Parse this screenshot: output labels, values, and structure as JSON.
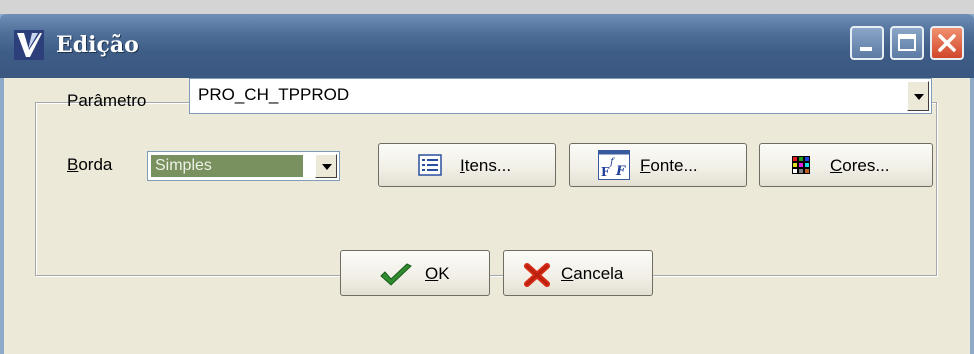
{
  "window": {
    "title": "Edição",
    "minimize_icon": "minimize-icon",
    "maximize_icon": "maximize-icon",
    "close_icon": "close-icon",
    "app_icon": "app-logo-icon"
  },
  "form": {
    "parametro": {
      "label": "Parâmetro",
      "value": "PRO_CH_TPPROD"
    },
    "borda": {
      "label_mnemonic": "B",
      "label_rest": "orda",
      "value": "Simples"
    }
  },
  "buttons": {
    "itens": {
      "mnemonic": "I",
      "rest": "tens...",
      "icon": "list-icon"
    },
    "fonte": {
      "mnemonic": "F",
      "rest": "onte...",
      "icon": "font-icon"
    },
    "cores": {
      "mnemonic": "C",
      "rest": "ores...",
      "icon": "color-palette-icon"
    },
    "ok": {
      "mnemonic": "O",
      "rest": "K",
      "icon": "checkmark-icon"
    },
    "cancela": {
      "mnemonic": "C",
      "rest": "ancela",
      "icon": "x-cancel-icon"
    }
  },
  "colors": {
    "titlebar": "#3e5d86",
    "face": "#ece9d8",
    "selection": "#79905f"
  }
}
